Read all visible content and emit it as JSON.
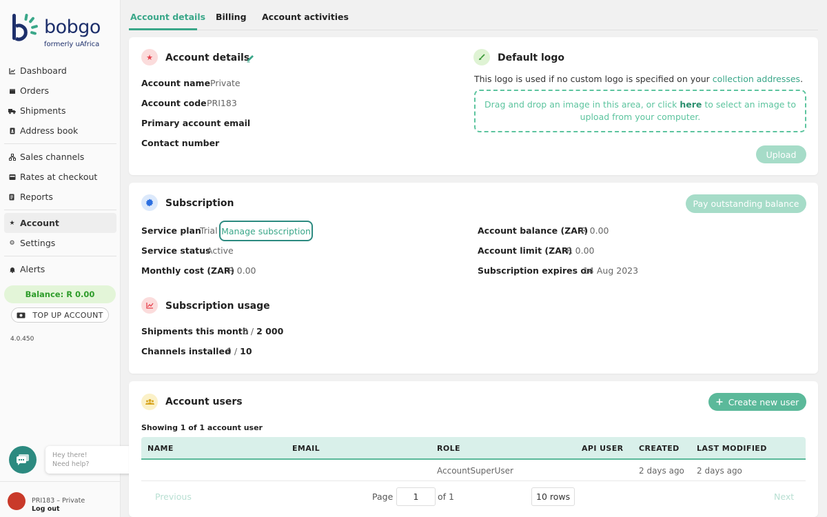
{
  "brand": {
    "name": "bobgo",
    "subtitle": "formerly uAfrica"
  },
  "sidebar": {
    "items": [
      {
        "label": "Dashboard",
        "icon": "chart-icon"
      },
      {
        "label": "Orders",
        "icon": "box-icon"
      },
      {
        "label": "Shipments",
        "icon": "truck-icon"
      },
      {
        "label": "Address book",
        "icon": "addressbook-icon"
      },
      {
        "label": "Sales channels",
        "icon": "channels-icon"
      },
      {
        "label": "Rates at checkout",
        "icon": "rates-icon"
      },
      {
        "label": "Reports",
        "icon": "report-icon"
      },
      {
        "label": "Account",
        "icon": "star-icon"
      },
      {
        "label": "Settings",
        "icon": "gear-icon"
      },
      {
        "label": "Alerts",
        "icon": "bell-icon"
      }
    ],
    "balance": "Balance: R 0.00",
    "topup": "TOP UP ACCOUNT",
    "version": "4.0.450",
    "chat": {
      "line1": "Hey there!",
      "line2": "Need help?"
    },
    "user": {
      "name": "PRI183 – Private",
      "logout": "Log out"
    }
  },
  "tabs": [
    "Account details",
    "Billing",
    "Account activities"
  ],
  "account_details": {
    "title": "Account details",
    "fields": [
      {
        "label": "Account name",
        "value": "Private"
      },
      {
        "label": "Account code",
        "value": "PRI183"
      },
      {
        "label": "Primary account email",
        "value": ""
      },
      {
        "label": "Contact number",
        "value": ""
      }
    ]
  },
  "default_logo": {
    "title": "Default logo",
    "desc_prefix": "This logo is used if no custom logo is specified on your ",
    "desc_link": "collection addresses",
    "desc_suffix": ".",
    "drop_prefix": "Drag and drop an image in this area, or click ",
    "drop_link": "here",
    "drop_suffix": " to select an image to upload from your computer.",
    "upload": "Upload"
  },
  "subscription": {
    "title": "Subscription",
    "pay_button": "Pay outstanding balance",
    "service_plan_label": "Service plan",
    "service_plan_value": "Trial",
    "manage": "Manage subscription",
    "service_status_label": "Service status",
    "service_status_value": "Active",
    "monthly_cost_label": "Monthly cost (ZAR)",
    "monthly_cost_value": "R 0.00",
    "balance_label": "Account balance (ZAR)",
    "balance_value": "R 0.00",
    "limit_label": "Account limit (ZAR)",
    "limit_value": "R 0.00",
    "expires_label": "Subscription expires on",
    "expires_value": "14 Aug 2023"
  },
  "usage": {
    "title": "Subscription usage",
    "shipments_label": "Shipments this month",
    "shipments_used": "0 / ",
    "shipments_max": "2 000",
    "channels_label": "Channels installed",
    "channels_used": "0 / ",
    "channels_max": "10"
  },
  "users": {
    "title": "Account users",
    "create": "Create new user",
    "showing": "Showing 1 of 1 account user",
    "columns": [
      "NAME",
      "EMAIL",
      "ROLE",
      "API USER",
      "CREATED",
      "LAST MODIFIED"
    ],
    "rows": [
      {
        "name": "",
        "email": "",
        "role": "AccountSuperUser",
        "api": "",
        "created": "2 days ago",
        "modified": "2 days ago"
      }
    ],
    "pager": {
      "previous": "Previous",
      "page_label": "Page",
      "page": "1",
      "of": "of 1",
      "rows": "10 rows",
      "next": "Next"
    }
  },
  "colors": {
    "accent": "#3aa789",
    "brand": "#1d2f6b"
  }
}
